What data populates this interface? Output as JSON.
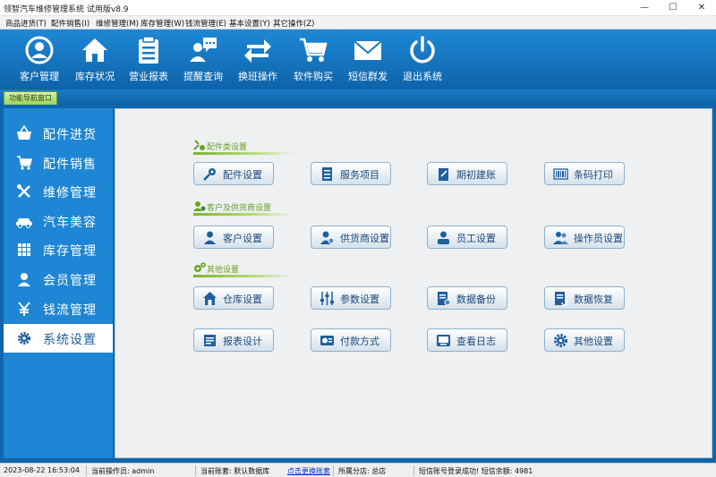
{
  "window": {
    "title": "领智汽车维修管理系统 试用版v8.9"
  },
  "menu": [
    "商品进货(T)",
    "配件销售(I)",
    "维修管理(M)",
    "库存管理(W)",
    "钱流管理(E)",
    "基本设置(Y)",
    "其它操作(Z)"
  ],
  "toolbar": [
    {
      "label": "客户管理",
      "icon": "person-circle-icon"
    },
    {
      "label": "库存状况",
      "icon": "house-icon"
    },
    {
      "label": "营业报表",
      "icon": "clipboard-icon"
    },
    {
      "label": "提醒查询",
      "icon": "chat-user-icon"
    },
    {
      "label": "换班操作",
      "icon": "swap-arrows-icon"
    },
    {
      "label": "软件购买",
      "icon": "cart-icon"
    },
    {
      "label": "短信群发",
      "icon": "envelope-icon"
    },
    {
      "label": "退出系统",
      "icon": "power-icon"
    }
  ],
  "nav_tab": "功能导航窗口",
  "sidebar": [
    {
      "label": "配件进货",
      "icon": "basket-icon"
    },
    {
      "label": "配件销售",
      "icon": "cart-icon"
    },
    {
      "label": "维修管理",
      "icon": "tools-icon"
    },
    {
      "label": "汽车美容",
      "icon": "car-icon"
    },
    {
      "label": "库存管理",
      "icon": "grid-icon"
    },
    {
      "label": "会员管理",
      "icon": "user-icon"
    },
    {
      "label": "钱流管理",
      "icon": "yen-icon"
    },
    {
      "label": "系统设置",
      "icon": "gear-icon",
      "active": true
    }
  ],
  "sections": [
    {
      "title": "配件类设置",
      "icon": "wrench-gear-icon",
      "buttons": [
        {
          "label": "配件设置",
          "icon": "parts-icon"
        },
        {
          "label": "服务项目",
          "icon": "document-list-icon"
        },
        {
          "label": "期初建账",
          "icon": "ledger-icon"
        },
        {
          "label": "条码打印",
          "icon": "barcode-icon"
        }
      ]
    },
    {
      "title": "客户及供货商设置",
      "icon": "users-icon",
      "buttons": [
        {
          "label": "客户设置",
          "icon": "user-icon"
        },
        {
          "label": "供货商设置",
          "icon": "user-gear-icon"
        },
        {
          "label": "员工设置",
          "icon": "employee-icon"
        },
        {
          "label": "操作员设置",
          "icon": "operator-icon"
        }
      ]
    },
    {
      "title": "其他设置",
      "icon": "gears-icon",
      "buttons": [
        {
          "label": "仓库设置",
          "icon": "warehouse-icon"
        },
        {
          "label": "参数设置",
          "icon": "sliders-icon"
        },
        {
          "label": "数据备份",
          "icon": "backup-icon"
        },
        {
          "label": "数据恢复",
          "icon": "restore-icon"
        },
        {
          "label": "报表设计",
          "icon": "report-icon"
        },
        {
          "label": "付款方式",
          "icon": "payment-card-icon"
        },
        {
          "label": "查看日志",
          "icon": "log-icon"
        },
        {
          "label": "其他设置",
          "icon": "gear-icon"
        }
      ]
    }
  ],
  "status": {
    "datetime": "2023-08-22 16:53:04",
    "operator": "当前操作员: admin",
    "account": "当前账套: 默认数据库",
    "switch_link": "点击更换账套",
    "branch": "所属分店: 总店",
    "sms": "短信账号登录成功! 短信余额: 4981"
  },
  "colors": {
    "toolbar": "#1479c4",
    "sidebar": "#1e86d4",
    "frame": "#0f66ad",
    "accent_green": "#6aa224",
    "content_bg": "#eef0f2"
  }
}
